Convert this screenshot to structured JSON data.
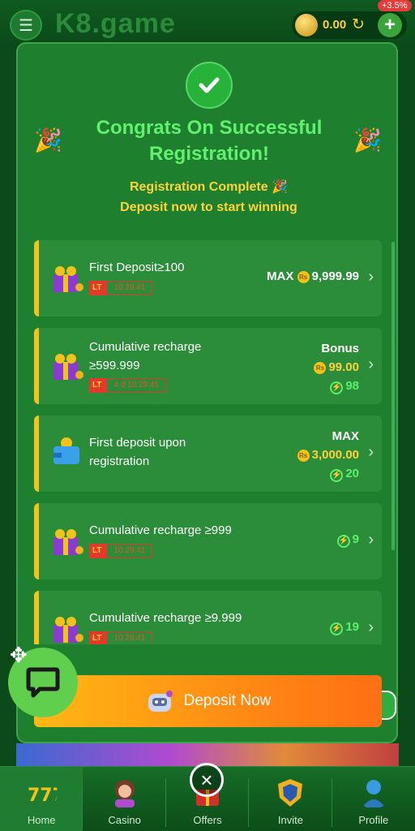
{
  "header": {
    "logo": "K8.game",
    "balance": "0.00",
    "bonus_pct": "+3.5%"
  },
  "modal": {
    "title": "Congrats On Successful Registration!",
    "subtitle_1": "Registration Complete 🎉",
    "subtitle_2": "Deposit now to start winning",
    "cards": [
      {
        "title": "First Deposit≥100",
        "lt": "LT",
        "timer": "10:29:41",
        "right_label": "MAX",
        "amount": "9,999.99"
      },
      {
        "title_line1": "Cumulative recharge",
        "title_line2": "≥599.999",
        "lt": "LT",
        "timer": "4 d 10:29:41",
        "right_label": "Bonus",
        "amount": "99.00",
        "bolt_value": "98"
      },
      {
        "title_line1": "First deposit upon",
        "title_line2": "registration",
        "right_label": "MAX",
        "amount": "3,000.00",
        "bolt_value": "20"
      },
      {
        "title": "Cumulative recharge ≥999",
        "lt": "LT",
        "timer": "10:29:41",
        "bolt_value": "9"
      },
      {
        "title": "Cumulative recharge ≥9.999",
        "lt": "LT",
        "timer": "10:29:41",
        "bolt_value": "19"
      }
    ],
    "deposit_button": "Deposit Now",
    "deposit_badge": "Deposit Now",
    "currency_symbol": "Rs"
  },
  "nav": {
    "items": [
      {
        "label": "Home",
        "icon": "slot-777-icon"
      },
      {
        "label": "Casino",
        "icon": "casino-girl-icon"
      },
      {
        "label": "Offers",
        "icon": "gift-icon"
      },
      {
        "label": "Invite",
        "icon": "invite-shield-icon"
      },
      {
        "label": "Profile",
        "icon": "profile-icon"
      }
    ]
  },
  "colors": {
    "modal_bg": "#1e7f2f",
    "title_green": "#62f06e",
    "accent_yellow": "#ffd23a",
    "deposit_orange": "#ff8a14"
  }
}
